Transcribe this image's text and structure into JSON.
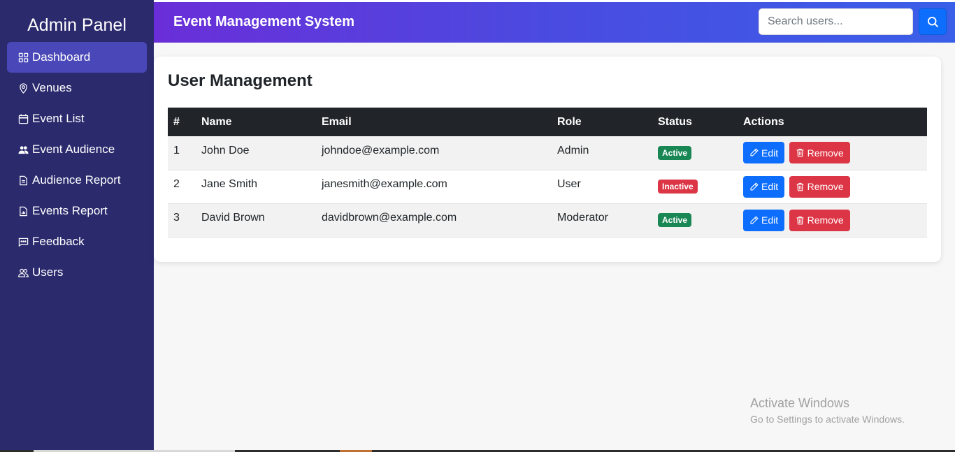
{
  "sidebar": {
    "title": "Admin Panel",
    "items": [
      {
        "label": "Dashboard",
        "icon": "grid-icon",
        "active": true
      },
      {
        "label": "Venues",
        "icon": "location-pin-icon"
      },
      {
        "label": "Event List",
        "icon": "calendar-icon"
      },
      {
        "label": "Event Audience",
        "icon": "people-icon"
      },
      {
        "label": "Audience Report",
        "icon": "document-icon"
      },
      {
        "label": "Events Report",
        "icon": "bar-chart-document-icon"
      },
      {
        "label": "Feedback",
        "icon": "chat-dots-icon"
      },
      {
        "label": "Users",
        "icon": "users-outline-icon"
      }
    ]
  },
  "header": {
    "title": "Event Management System",
    "search_placeholder": "Search users...",
    "search_icon": "search-icon"
  },
  "main": {
    "title": "User Management",
    "table": {
      "columns": [
        "#",
        "Name",
        "Email",
        "Role",
        "Status",
        "Actions"
      ],
      "rows": [
        {
          "num": "1",
          "name": "John Doe",
          "email": "johndoe@example.com",
          "role": "Admin",
          "status": "Active"
        },
        {
          "num": "2",
          "name": "Jane Smith",
          "email": "janesmith@example.com",
          "role": "User",
          "status": "Inactive"
        },
        {
          "num": "3",
          "name": "David Brown",
          "email": "davidbrown@example.com",
          "role": "Moderator",
          "status": "Active"
        }
      ],
      "edit_label": "Edit",
      "remove_label": "Remove"
    }
  },
  "watermark": {
    "title": "Activate Windows",
    "subtitle": "Go to Settings to activate Windows."
  },
  "colors": {
    "sidebar_bg": "#2b2a6d",
    "sidebar_active": "#4a48b8",
    "header_gradient_start": "#6a2ed8",
    "header_gradient_end": "#3a5fe8",
    "primary": "#0d6efd",
    "danger": "#dc3545",
    "success": "#198754",
    "table_header": "#212529"
  }
}
